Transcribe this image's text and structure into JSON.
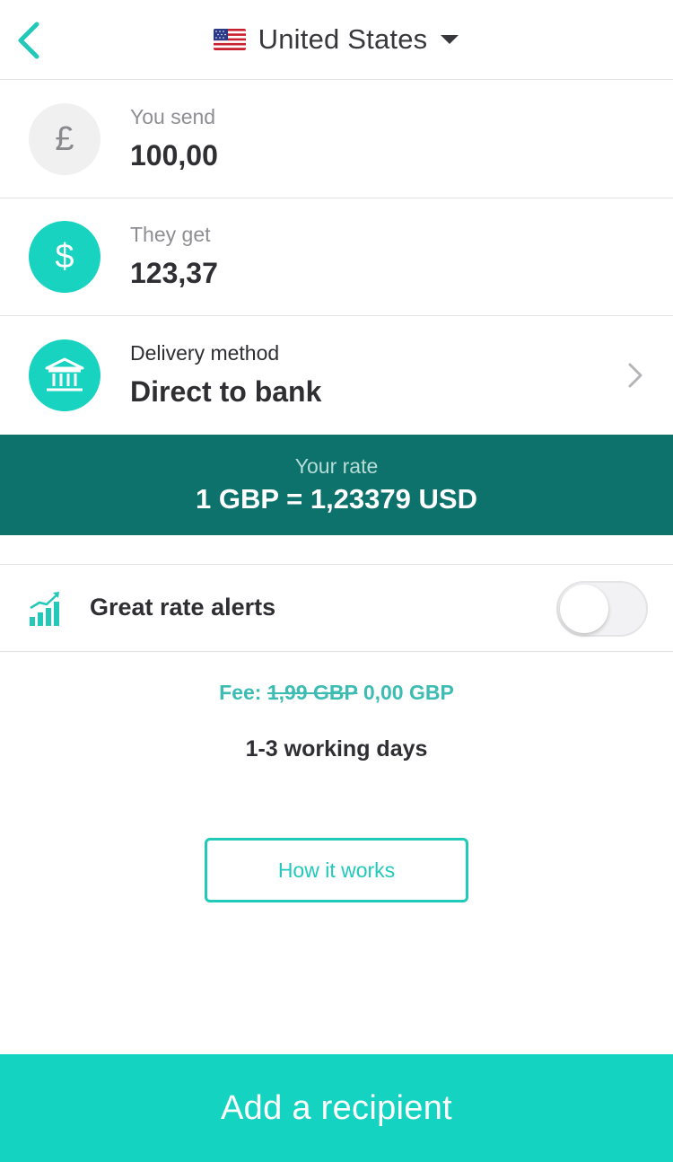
{
  "header": {
    "back_icon": "chevron-left-icon",
    "flag_icon": "us-flag-icon",
    "country": "United States",
    "dropdown_icon": "caret-down-icon"
  },
  "send": {
    "currency_symbol": "£",
    "label": "You send",
    "amount": "100,00"
  },
  "receive": {
    "currency_symbol": "$",
    "label": "They get",
    "amount": "123,37"
  },
  "delivery": {
    "icon": "bank-icon",
    "label": "Delivery method",
    "value": "Direct to bank"
  },
  "rate": {
    "label": "Your rate",
    "value": "1 GBP = 1,23379 USD"
  },
  "alerts": {
    "icon": "chart-trend-icon",
    "label": "Great rate alerts",
    "enabled": false
  },
  "fee": {
    "prefix": "Fee:",
    "old": "1,99 GBP",
    "new": "0,00 GBP"
  },
  "delivery_time": "1-3 working days",
  "how_it_works_label": "How it works",
  "cta_label": "Add a recipient",
  "colors": {
    "accent": "#14d3c1",
    "rate_bar": "#0c726b",
    "text": "#2e2e33"
  }
}
